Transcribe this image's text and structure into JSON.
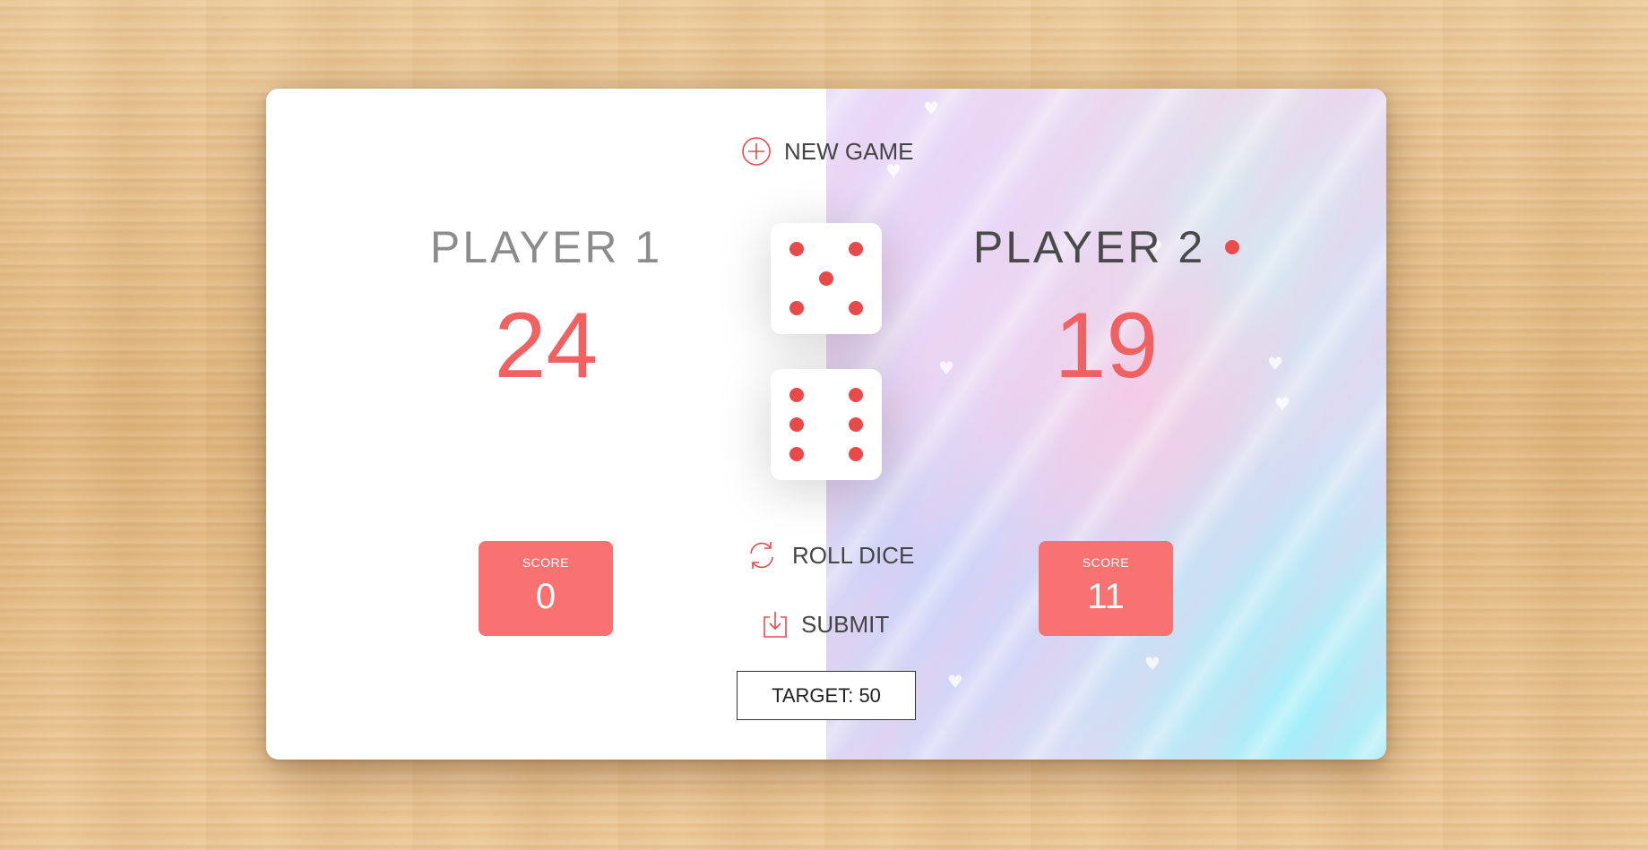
{
  "controls": {
    "new_game_label": "NEW GAME",
    "roll_dice_label": "ROLL DICE",
    "submit_label": "SUBMIT",
    "target_text": "TARGET: 50"
  },
  "players": [
    {
      "name": "PLAYER 1",
      "total_score": "24",
      "current_label": "SCORE",
      "current_score": "0",
      "active": false
    },
    {
      "name": "PLAYER 2",
      "total_score": "19",
      "current_label": "SCORE",
      "current_score": "11",
      "active": true
    }
  ],
  "dice": [
    {
      "value": 5
    },
    {
      "value": 6
    }
  ],
  "colors": {
    "accent": "#e84a4a",
    "score_box": "#f87272",
    "score_text": "#f06161"
  },
  "icons": {
    "new_game": "plus-circle-icon",
    "roll_dice": "refresh-icon",
    "submit": "download-icon",
    "active_player": "active-dot-icon"
  }
}
